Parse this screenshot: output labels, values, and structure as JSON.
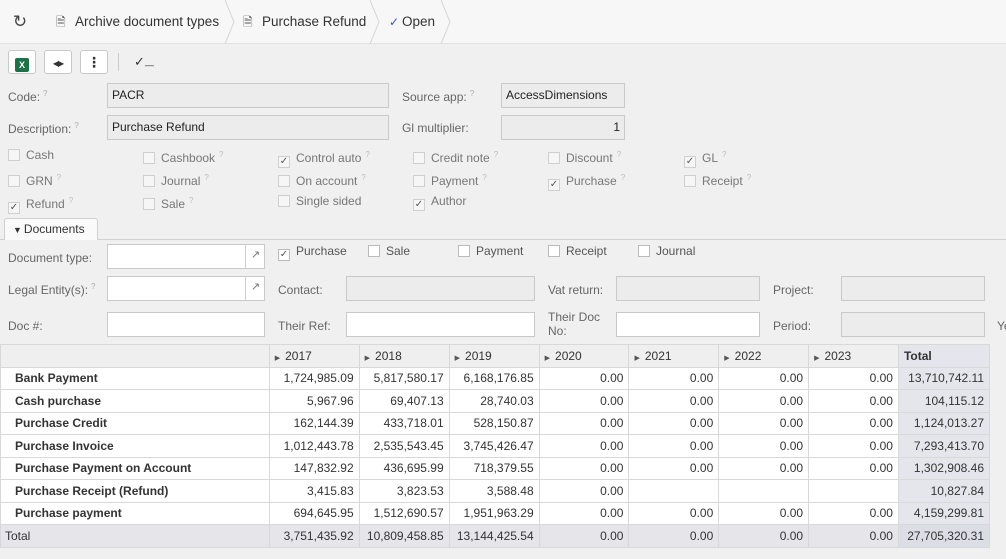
{
  "breadcrumbs": {
    "refresh_icon": "refresh-icon",
    "items": [
      {
        "label": "Archive document types",
        "icon": "document-settings-icon"
      },
      {
        "label": "Purchase Refund",
        "icon": "document-settings-icon"
      },
      {
        "label": "Open",
        "icon": "edit-icon"
      }
    ]
  },
  "toolbar": {
    "excel_icon": "excel-icon",
    "expand_icon": "expand-arrows-icon",
    "more_icon": "more-vertical-icon",
    "edit_icon": "edit-check-icon"
  },
  "form": {
    "code_label": "Code:",
    "code_value": "PACR",
    "source_app_label": "Source app:",
    "source_app_value": "AccessDimensions",
    "description_label": "Description:",
    "description_value": "Purchase Refund",
    "gl_multiplier_label": "Gl multiplier:",
    "gl_multiplier_value": "1",
    "help_mark": "?"
  },
  "flags": [
    {
      "label": "Cash",
      "checked": false,
      "hint": false
    },
    {
      "label": "Cashbook",
      "checked": false,
      "hint": true
    },
    {
      "label": "Control auto",
      "checked": true,
      "hint": true
    },
    {
      "label": "Credit note",
      "checked": false,
      "hint": true
    },
    {
      "label": "Discount",
      "checked": false,
      "hint": true
    },
    {
      "label": "GL",
      "checked": true,
      "hint": true
    },
    {
      "label": "GRN",
      "checked": false,
      "hint": true
    },
    {
      "label": "Journal",
      "checked": false,
      "hint": true
    },
    {
      "label": "On account",
      "checked": false,
      "hint": true
    },
    {
      "label": "Payment",
      "checked": false,
      "hint": true
    },
    {
      "label": "Purchase",
      "checked": true,
      "hint": true
    },
    {
      "label": "Receipt",
      "checked": false,
      "hint": true
    },
    {
      "label": "Refund",
      "checked": true,
      "hint": true
    },
    {
      "label": "Sale",
      "checked": false,
      "hint": true
    },
    {
      "label": "Single sided",
      "checked": false,
      "hint": false
    },
    {
      "label": "Author",
      "checked": true,
      "hint": false
    }
  ],
  "tab": {
    "label": "Documents",
    "icon": "filter-icon"
  },
  "filters": {
    "document_type_label": "Document type:",
    "legal_entity_label": "Legal Entity(s):",
    "doc_no_label": "Doc #:",
    "contact_label": "Contact:",
    "their_ref_label": "Their Ref:",
    "vat_return_label": "Vat return:",
    "their_doc_no_label": "Their Doc No:",
    "project_label": "Project:",
    "period_label": "Period:",
    "cut_label": "Ye",
    "doc_checks": [
      {
        "label": "Purchase",
        "checked": true
      },
      {
        "label": "Sale",
        "checked": false
      },
      {
        "label": "Payment",
        "checked": false
      },
      {
        "label": "Receipt",
        "checked": false
      },
      {
        "label": "Journal",
        "checked": false
      }
    ]
  },
  "table": {
    "columns": [
      "2017",
      "2018",
      "2019",
      "2020",
      "2021",
      "2022",
      "2023",
      "Total"
    ],
    "rows": [
      {
        "name": "Bank Payment",
        "values": [
          "1,724,985.09",
          "5,817,580.17",
          "6,168,176.85",
          "0.00",
          "0.00",
          "0.00",
          "0.00",
          "13,710,742.11"
        ]
      },
      {
        "name": "Cash purchase",
        "values": [
          "5,967.96",
          "69,407.13",
          "28,740.03",
          "0.00",
          "0.00",
          "0.00",
          "0.00",
          "104,115.12"
        ]
      },
      {
        "name": "Purchase Credit",
        "values": [
          "162,144.39",
          "433,718.01",
          "528,150.87",
          "0.00",
          "0.00",
          "0.00",
          "0.00",
          "1,124,013.27"
        ]
      },
      {
        "name": "Purchase Invoice",
        "values": [
          "1,012,443.78",
          "2,535,543.45",
          "3,745,426.47",
          "0.00",
          "0.00",
          "0.00",
          "0.00",
          "7,293,413.70"
        ]
      },
      {
        "name": "Purchase Payment on Account",
        "values": [
          "147,832.92",
          "436,695.99",
          "718,379.55",
          "0.00",
          "0.00",
          "0.00",
          "0.00",
          "1,302,908.46"
        ]
      },
      {
        "name": "Purchase Receipt (Refund)",
        "values": [
          "3,415.83",
          "3,823.53",
          "3,588.48",
          "0.00",
          "",
          "",
          "",
          "10,827.84"
        ]
      },
      {
        "name": "Purchase payment",
        "values": [
          "694,645.95",
          "1,512,690.57",
          "1,951,963.29",
          "0.00",
          "0.00",
          "0.00",
          "0.00",
          "4,159,299.81"
        ]
      }
    ],
    "total_row": {
      "name": "Total",
      "values": [
        "3,751,435.92",
        "10,809,458.85",
        "13,144,425.54",
        "0.00",
        "0.00",
        "0.00",
        "0.00",
        "27,705,320.31"
      ]
    }
  }
}
